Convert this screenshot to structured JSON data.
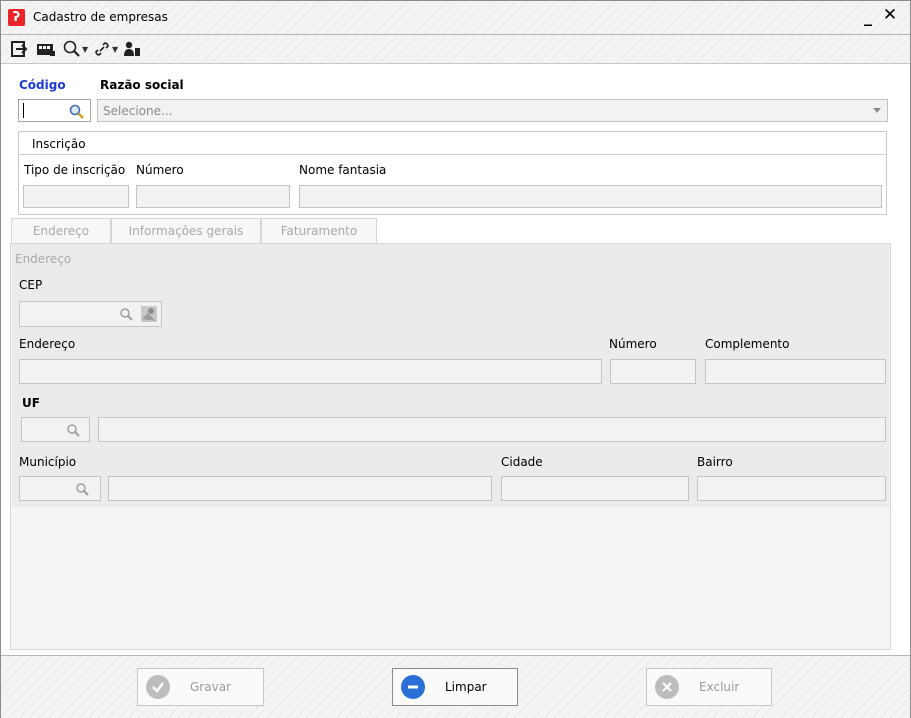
{
  "window": {
    "title": "Cadastro de empresas",
    "logo_glyph": "ʔ",
    "minimize_glyph": "_",
    "close_glyph": "✕"
  },
  "toolbar": {
    "items": [
      "exit-icon",
      "card-icon",
      "search-icon",
      "link-icon",
      "user-icon"
    ]
  },
  "header": {
    "codigo_label": "Código",
    "razao_label": "Razão social",
    "codigo_value": "",
    "razao_placeholder": "Selecione..."
  },
  "inscricao": {
    "title": "Inscrição",
    "tipo_label": "Tipo de inscrição",
    "numero_label": "Número",
    "fantasia_label": "Nome fantasia"
  },
  "tabs": [
    {
      "label": "Endereço"
    },
    {
      "label": "Informações gerais"
    },
    {
      "label": "Faturamento"
    }
  ],
  "endereco": {
    "section_title": "Endereço",
    "cep_label": "CEP",
    "endereco_label": "Endereço",
    "numero_label": "Número",
    "complemento_label": "Complemento",
    "uf_label": "UF",
    "municipio_label": "Município",
    "cidade_label": "Cidade",
    "bairro_label": "Bairro"
  },
  "footer": {
    "gravar": "Gravar",
    "limpar": "Limpar",
    "excluir": "Excluir"
  },
  "colors": {
    "accent_blue": "#1a3ad6",
    "logo_red": "#e8232a",
    "limpar_blue": "#2a6fd6"
  }
}
